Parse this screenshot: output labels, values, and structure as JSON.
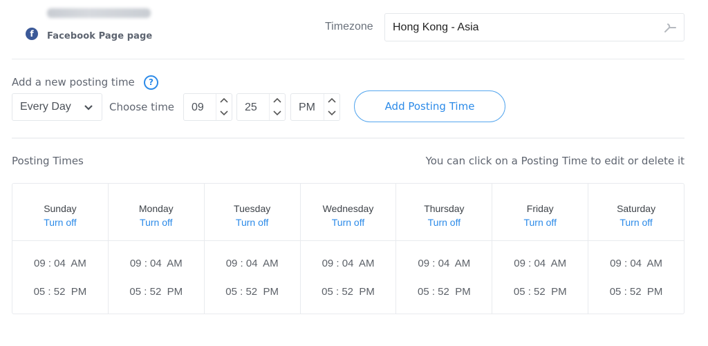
{
  "header": {
    "page_type": "Facebook Page page",
    "timezone_label": "Timezone",
    "timezone_value": "Hong Kong - Asia",
    "timezone_icon": "pin-icon"
  },
  "add_posting": {
    "label": "Add a new posting time",
    "help_icon": "?",
    "day_select": "Every Day",
    "choose_time_label": "Choose time",
    "hour": "09",
    "minute": "25",
    "ampm": "PM",
    "button_label": "Add Posting Time"
  },
  "posting_times": {
    "title": "Posting Times",
    "hint": "You can click on a Posting Time to edit or delete it",
    "days": [
      {
        "day": "Sunday",
        "action": "Turn off",
        "times": [
          "09 : 04  AM",
          "05 : 52  PM"
        ]
      },
      {
        "day": "Monday",
        "action": "Turn off",
        "times": [
          "09 : 04  AM",
          "05 : 52  PM"
        ]
      },
      {
        "day": "Tuesday",
        "action": "Turn off",
        "times": [
          "09 : 04  AM",
          "05 : 52  PM"
        ]
      },
      {
        "day": "Wednesday",
        "action": "Turn off",
        "times": [
          "09 : 04  AM",
          "05 : 52  PM"
        ]
      },
      {
        "day": "Thursday",
        "action": "Turn off",
        "times": [
          "09 : 04  AM",
          "05 : 52  PM"
        ]
      },
      {
        "day": "Friday",
        "action": "Turn off",
        "times": [
          "09 : 04  AM",
          "05 : 52  PM"
        ]
      },
      {
        "day": "Saturday",
        "action": "Turn off",
        "times": [
          "09 : 04  AM",
          "05 : 52  PM"
        ]
      }
    ]
  },
  "colors": {
    "accent": "#2b8ae8",
    "facebook": "#3b5998",
    "border": "#e8eaee"
  }
}
